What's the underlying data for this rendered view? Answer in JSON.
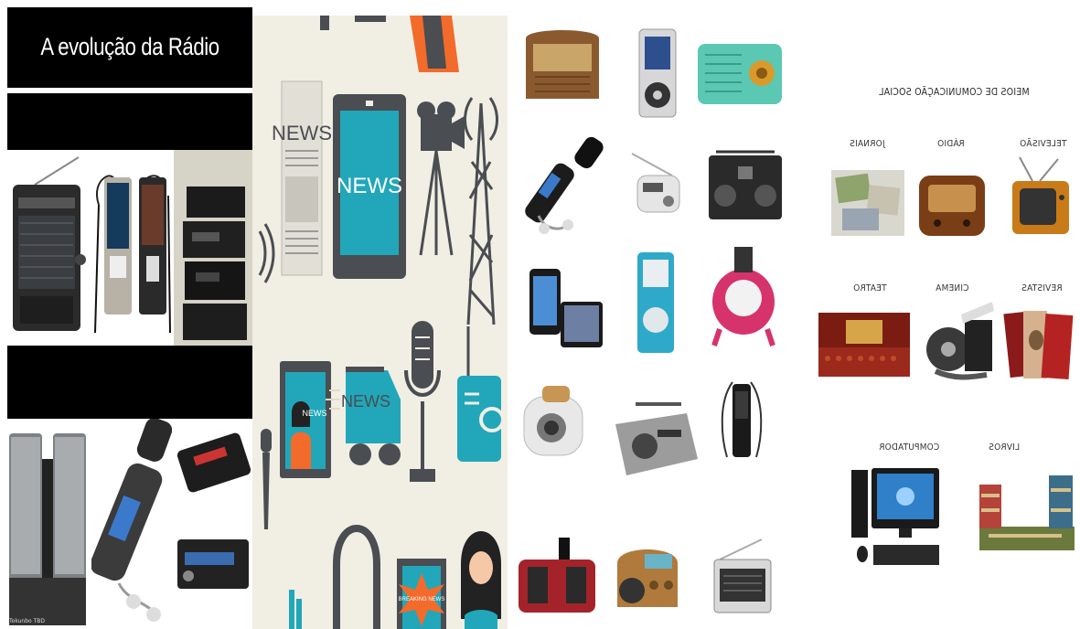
{
  "panel1": {
    "title": "A evolução da Rádio",
    "watermark": "Tokunbo TBD"
  },
  "panel2": {
    "icon_labels": {
      "newspaper": "NEWS",
      "tablet": "NEWS",
      "tv_presenter": "NEWS",
      "van": "NEWS",
      "breaking": "BREAKING NEWS"
    }
  },
  "panel4": {
    "heading": "MEIOS DE COMUNICAÇÃO SOCIAL",
    "labels": {
      "television": "TELEVISÃO",
      "radio": "RÁDIO",
      "newspapers": "JORNAIS",
      "magazines": "REVISTAS",
      "cinema": "CINEMA",
      "theatre": "TEATRO",
      "books": "LIVROS",
      "computer": "COMPUTADOR"
    }
  },
  "colors": {
    "panel2_bg": "#f1eee4",
    "icon_dark": "#4a4d52",
    "icon_teal": "#21a7b9",
    "icon_orange": "#f26b2b"
  }
}
